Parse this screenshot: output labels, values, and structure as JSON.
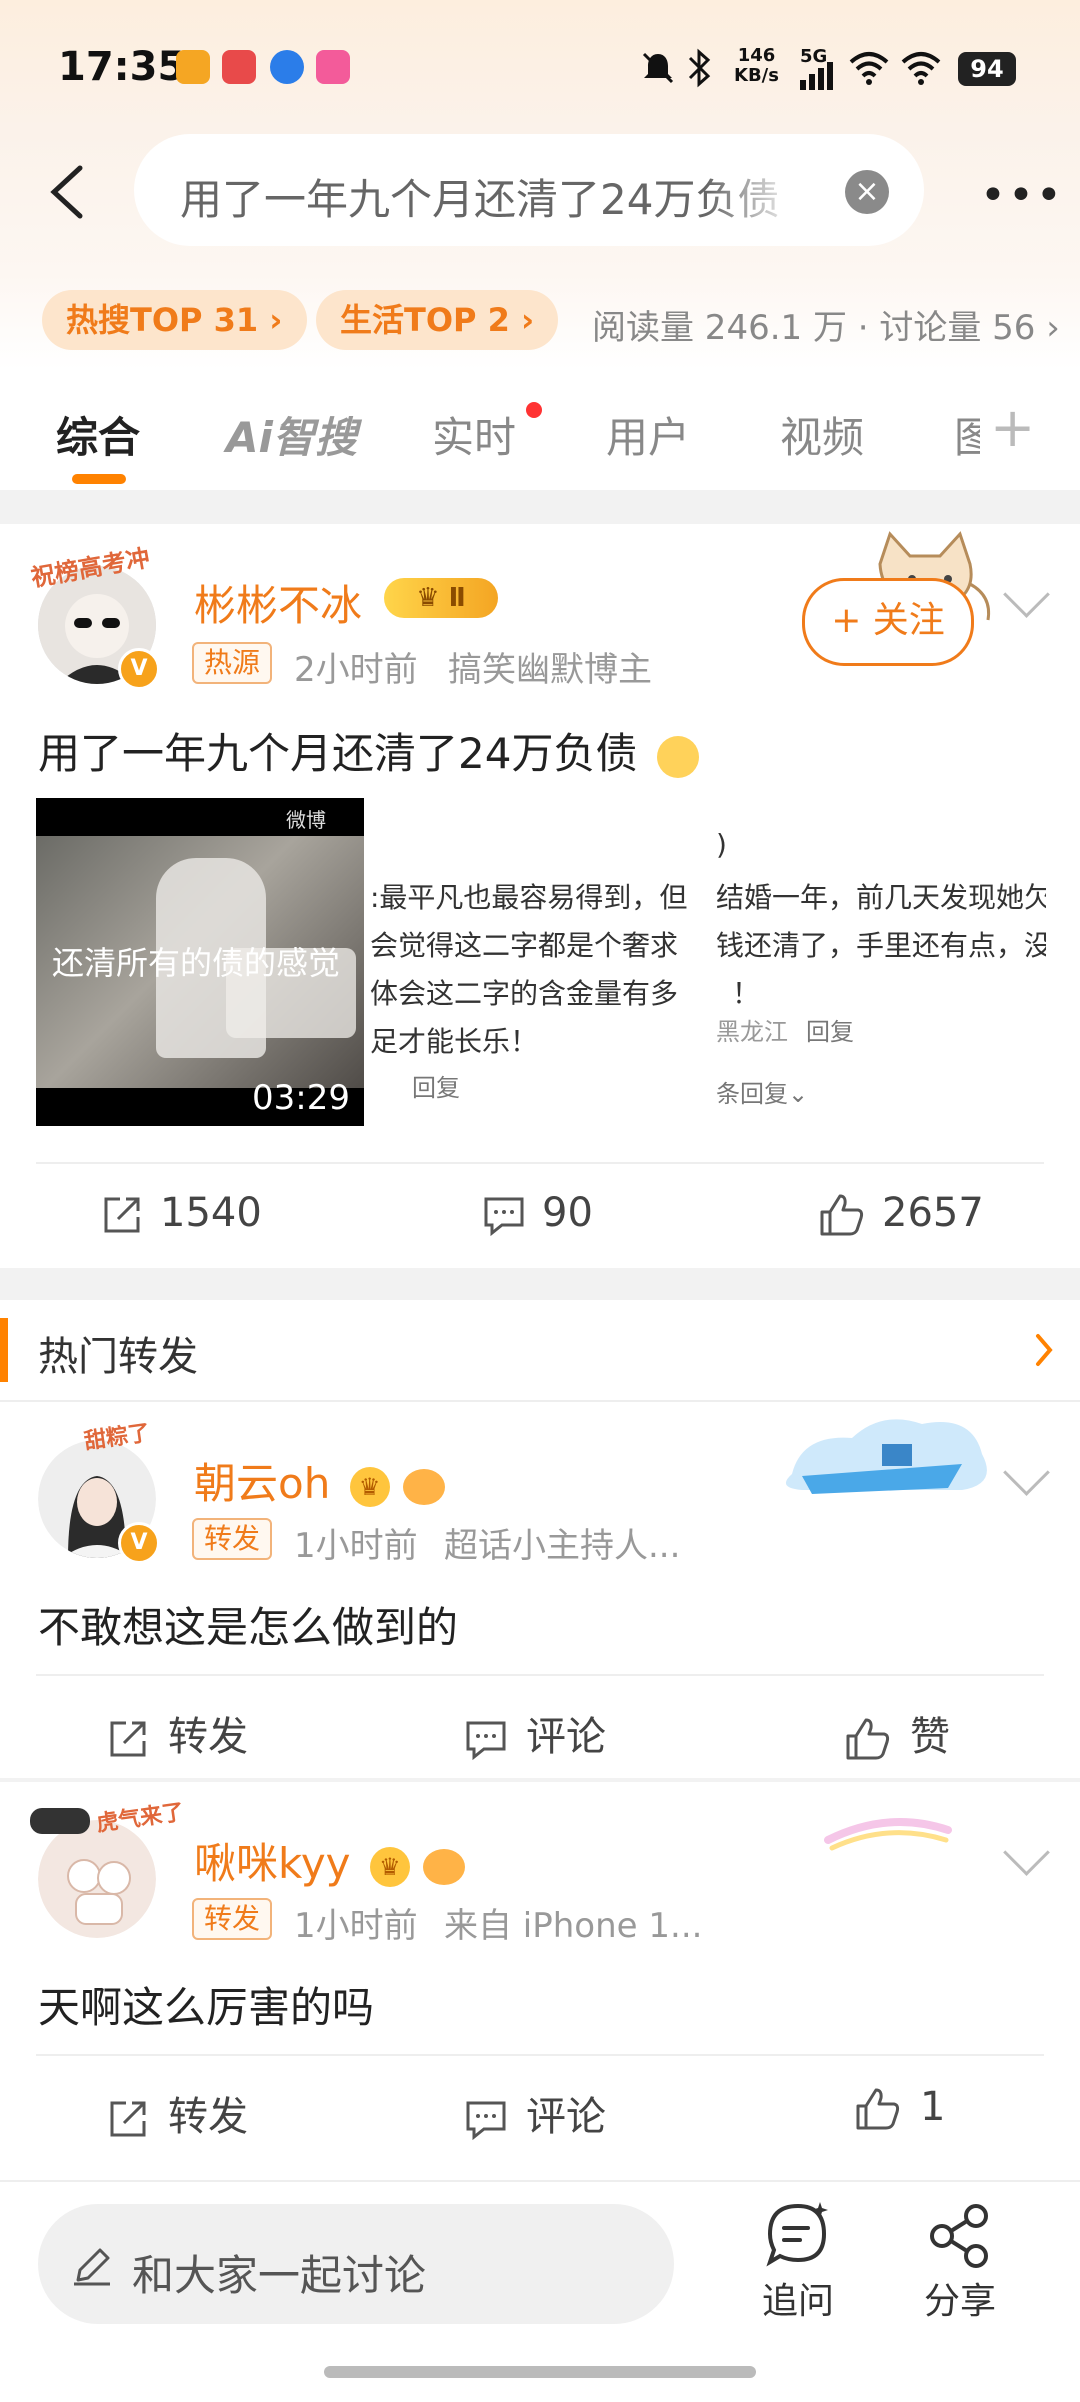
{
  "status_bar": {
    "time": "17:35",
    "net_speed_top": "146",
    "net_speed_unit": "KB/s",
    "signal": "5G",
    "battery": "94"
  },
  "header": {
    "search_text": "用了一年九个月还清了24万负债",
    "chips": [
      "热搜TOP 31 ›",
      "生活TOP 2 ›"
    ],
    "stats": "阅读量 246.1 万 · 讨论量 56 ›"
  },
  "tabs": [
    "综合",
    "Ai智搜",
    "实时",
    "用户",
    "视频",
    "图"
  ],
  "post": {
    "username": "彬彬不冰",
    "level_badge": "Ⅱ",
    "avatar_banner": "祝榜高考冲",
    "source_tag": "热源",
    "time": "2小时前",
    "role": "搞笑幽默博主",
    "follow_label": "+ 关注",
    "text": "用了一年九个月还清了24万负债",
    "video_caption": "还清所有的债的感觉",
    "video_duration": "03:29",
    "video_watermark": "微博",
    "snippet_left": [
      ":最平凡也最容易得到，但",
      "会觉得这二字都是个奢求",
      "体会这二字的含金量有多",
      "足才能长乐！"
    ],
    "snippet_left_reply": "回复",
    "snippet_right": [
      ")",
      "结婚一年，前几天发现她欠了",
      "钱还清了，手里还有点，没",
      "！"
    ],
    "snippet_right_loc": "黑龙江",
    "snippet_right_reply": "回复",
    "snippet_right_more": "条回复",
    "reposts": "1540",
    "comments": "90",
    "likes": "2657"
  },
  "hot_section": {
    "title": "热门转发"
  },
  "reposts": [
    {
      "username": "朝云oh",
      "avatar_banner": "甜粽了",
      "tag": "转发",
      "time": "1小时前",
      "source": "超话小主持人...",
      "text": "不敢想这是怎么做到的",
      "repost_label": "转发",
      "comment_label": "评论",
      "like_label": "赞"
    },
    {
      "username": "啾咪kyy",
      "avatar_banner": "虎气来了",
      "tag": "转发",
      "time": "1小时前",
      "source": "来自 iPhone 1...",
      "text": "天啊这么厉害的吗",
      "repost_label": "转发",
      "comment_label": "评论",
      "like_label": "1"
    }
  ],
  "bottom_bar": {
    "input_placeholder": "和大家一起讨论",
    "ask_label": "追问",
    "share_label": "分享"
  },
  "colors": {
    "accent": "#ff8200",
    "username": "#f07b1a"
  }
}
